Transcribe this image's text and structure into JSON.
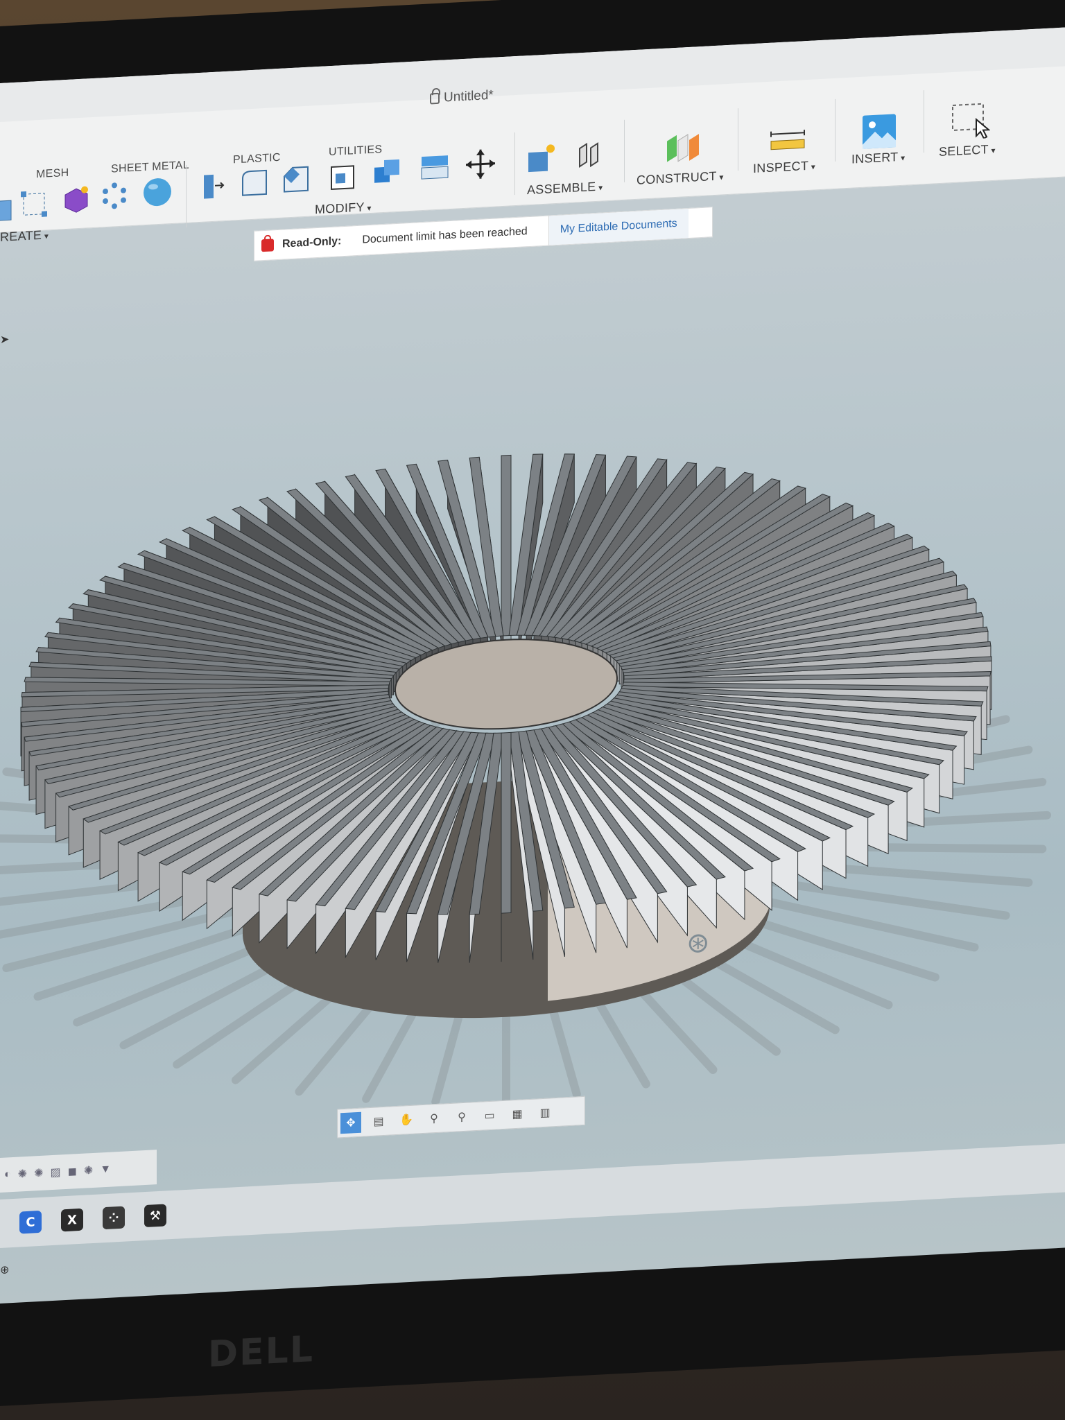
{
  "window": {
    "title": "Untitled*"
  },
  "toolbar": {
    "tabs": [
      "MESH",
      "SHEET METAL",
      "PLASTIC",
      "UTILITIES"
    ],
    "groups": {
      "create": "REATE",
      "modify": "MODIFY",
      "assemble": "ASSEMBLE",
      "construct": "CONSTRUCT",
      "inspect": "INSPECT",
      "insert": "INSERT",
      "select": "SELECT"
    }
  },
  "banner": {
    "readonly_label": "Read-Only:",
    "message": "Document limit has been reached",
    "link": "My Editable Documents"
  },
  "navbar": {
    "icons": [
      "orbit-move-icon",
      "look-at-icon",
      "pan-icon",
      "zoom-icon",
      "zoom-window-icon",
      "display-settings-icon",
      "grid-icon",
      "viewports-icon"
    ]
  },
  "taskbar": {
    "apps": [
      {
        "label": "C",
        "color": "#2f6ed6"
      },
      {
        "label": "X",
        "color": "#2a2a2a"
      },
      {
        "label": "⁘",
        "color": "#3a3a3a"
      },
      {
        "label": "⚒",
        "color": "#2a2a2a"
      }
    ]
  },
  "bezel": {
    "brand": "DELL"
  },
  "colors": {
    "viewport_bg": "#b8c6cc",
    "toolbar_bg": "#f1f2f2",
    "fin_dark": "#5f6569",
    "fin_light": "#e9e6e0",
    "link": "#2c6bb3",
    "lock_red": "#d92b2b"
  }
}
